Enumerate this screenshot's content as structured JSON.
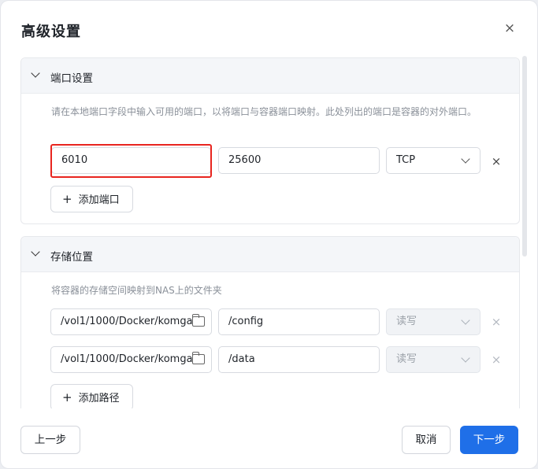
{
  "dialog": {
    "title": "高级设置",
    "close": "×"
  },
  "ports": {
    "title": "端口设置",
    "description": "请在本地端口字段中输入可用的端口，以将端口与容器端口映射。此处列出的端口是容器的对外端口。",
    "rows": [
      {
        "local_port": "6010",
        "container_port": "25600",
        "protocol": "TCP"
      }
    ],
    "add_label": "添加端口"
  },
  "storage": {
    "title": "存储位置",
    "description": "将容器的存储空间映射到NAS上的文件夹",
    "rows": [
      {
        "host_path": "/vol1/1000/Docker/komga",
        "container_path": "/config",
        "permission": "读写"
      },
      {
        "host_path": "/vol1/1000/Docker/komga",
        "container_path": "/data",
        "permission": "读写"
      }
    ],
    "add_label": "添加路径"
  },
  "footer": {
    "prev": "上一步",
    "cancel": "取消",
    "next": "下一步"
  },
  "colors": {
    "primary": "#1f6fe8",
    "highlight": "#e8251f"
  }
}
